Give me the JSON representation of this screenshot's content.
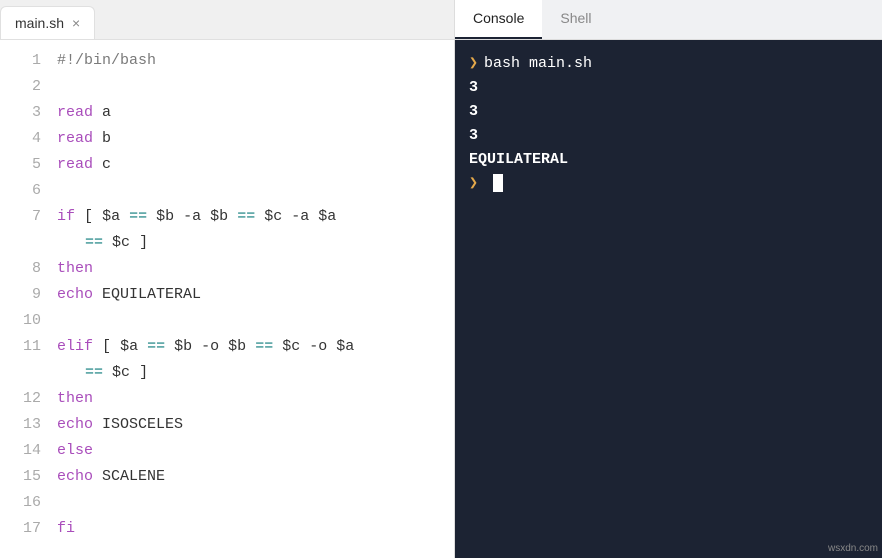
{
  "editor": {
    "tab": {
      "label": "main.sh"
    },
    "lines": [
      {
        "n": "1",
        "html": "<span class='comment'>#!/bin/bash</span>"
      },
      {
        "n": "2",
        "html": ""
      },
      {
        "n": "3",
        "html": "<span class='kw'>read</span> a"
      },
      {
        "n": "4",
        "html": "<span class='kw'>read</span> b"
      },
      {
        "n": "5",
        "html": "<span class='kw'>read</span> c"
      },
      {
        "n": "6",
        "html": ""
      },
      {
        "n": "7",
        "html": "<span class='kw'>if</span> <span class='brack'>[</span> <span class='var'>$a</span> <span class='op'>==</span> <span class='var'>$b</span> -a <span class='var'>$b</span> <span class='op'>==</span> <span class='var'>$c</span> -a <span class='var'>$a</span>",
        "wrap": "<span class='op'>==</span> <span class='var'>$c</span> <span class='brack'>]</span>"
      },
      {
        "n": "8",
        "html": "<span class='kw'>then</span>"
      },
      {
        "n": "9",
        "html": "<span class='kw'>echo</span> EQUILATERAL"
      },
      {
        "n": "10",
        "html": ""
      },
      {
        "n": "11",
        "html": "<span class='kw'>elif</span> <span class='brack'>[</span> <span class='var'>$a</span> <span class='op'>==</span> <span class='var'>$b</span> -o <span class='var'>$b</span> <span class='op'>==</span> <span class='var'>$c</span> -o <span class='var'>$a</span>",
        "wrap": "<span class='op'>==</span> <span class='var'>$c</span> <span class='brack'>]</span>"
      },
      {
        "n": "12",
        "html": "<span class='kw'>then</span>"
      },
      {
        "n": "13",
        "html": "<span class='kw'>echo</span> ISOSCELES"
      },
      {
        "n": "14",
        "html": "<span class='kw'>else</span>"
      },
      {
        "n": "15",
        "html": "<span class='kw'>echo</span> SCALENE"
      },
      {
        "n": "16",
        "html": ""
      },
      {
        "n": "17",
        "html": "<span class='kw'>fi</span>"
      }
    ]
  },
  "console": {
    "tabs": [
      {
        "label": "Console",
        "active": true
      },
      {
        "label": "Shell",
        "active": false
      }
    ],
    "prompt_glyph": "❯",
    "command": "bash main.sh",
    "output": [
      "3",
      "3",
      "3",
      "EQUILATERAL"
    ]
  },
  "watermark": "wsxdn.com"
}
